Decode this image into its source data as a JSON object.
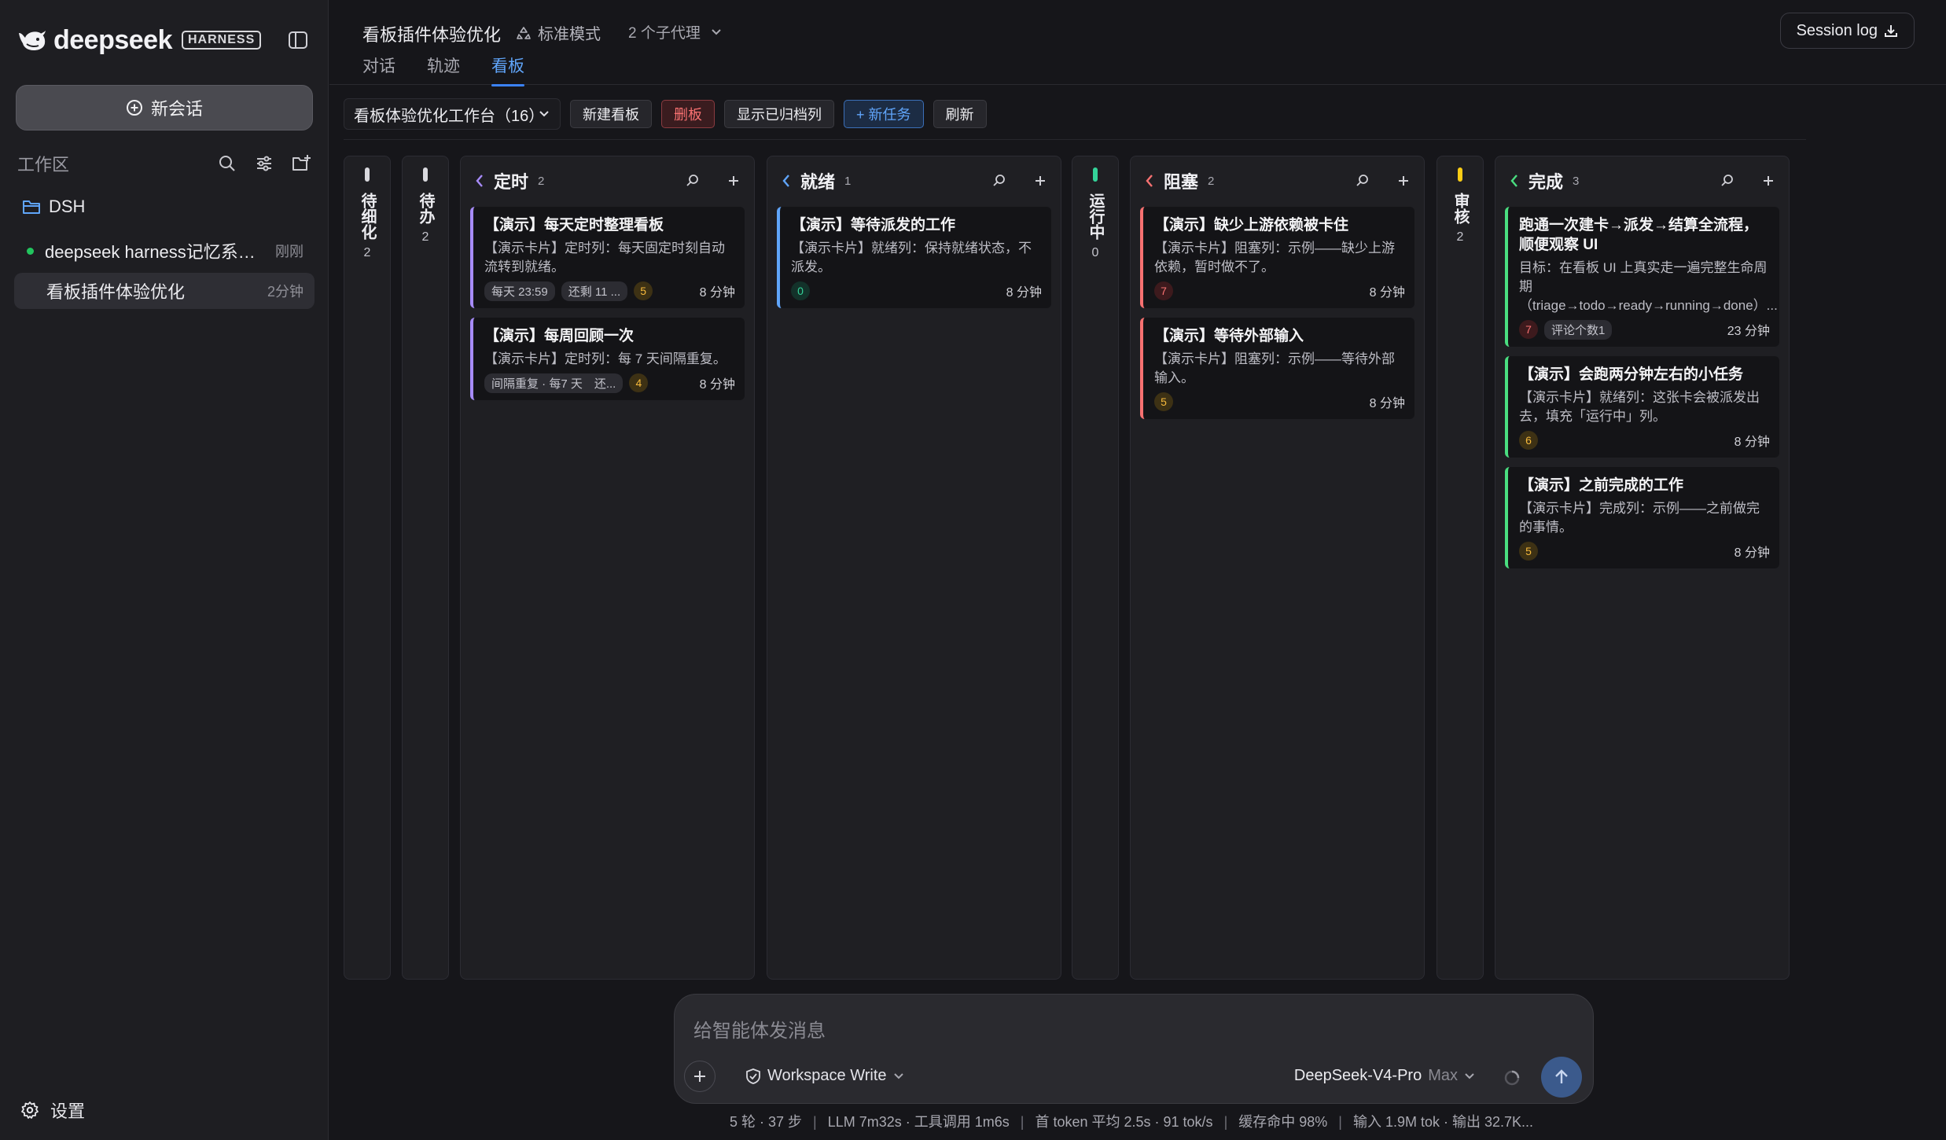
{
  "sidebar": {
    "logo_word": "deepseek",
    "logo_badge": "HARNESS",
    "new_chat_label": "新会话",
    "workspace_title": "工作区",
    "folder_name": "DSH",
    "sessions": [
      {
        "name": "deepseek harness记忆系统工程化落地方案",
        "time": "刚刚",
        "running": true
      },
      {
        "name": "看板插件体验优化",
        "time": "2分钟",
        "active": true
      }
    ],
    "settings_label": "设置"
  },
  "header": {
    "title": "看板插件体验优化",
    "mode": "标准模式",
    "agents": "2 个子代理",
    "tabs": [
      "对话",
      "轨迹",
      "看板"
    ],
    "active_tab": "看板",
    "session_log": "Session log"
  },
  "toolbar": {
    "board_select": "看板体验优化工作台（16）",
    "new_board": "新建看板",
    "delete_board": "删板",
    "show_archived": "显示已归档列",
    "new_task": "+ 新任务",
    "refresh": "刷新"
  },
  "columns": [
    {
      "key": "triage",
      "title": "待细化",
      "count": "2",
      "collapsed": true,
      "color": "#d9d9de"
    },
    {
      "key": "todo",
      "title": "待办",
      "count": "2",
      "collapsed": true,
      "color": "#d9d9de"
    },
    {
      "key": "scheduled",
      "title": "定时",
      "count": "2",
      "collapsed": false,
      "color": "#a78bfa",
      "cards": [
        {
          "title": "【演示】每天定时整理看板",
          "desc": "【演示卡片】定时列：每天固定时刻自动流转到就绪。",
          "tags": [
            "每天 23:59",
            "还剩 11 ..."
          ],
          "prio": "5",
          "prio_color": "y",
          "time": "8 分钟"
        },
        {
          "title": "【演示】每周回顾一次",
          "desc": "【演示卡片】定时列：每 7 天间隔重复。",
          "tags": [
            "间隔重复 · 每7 天　还..."
          ],
          "prio": "4",
          "prio_color": "y",
          "time": "8 分钟"
        }
      ]
    },
    {
      "key": "ready",
      "title": "就绪",
      "count": "1",
      "collapsed": false,
      "color": "#60a5fa",
      "cards": [
        {
          "title": "【演示】等待派发的工作",
          "desc": "【演示卡片】就绪列：保持就绪状态，不派发。",
          "tags": [],
          "prio": "0",
          "prio_color": "g",
          "time": "8 分钟"
        }
      ]
    },
    {
      "key": "running",
      "title": "运行中",
      "count": "0",
      "collapsed": true,
      "color": "#34d399"
    },
    {
      "key": "blocked",
      "title": "阻塞",
      "count": "2",
      "collapsed": false,
      "color": "#f87171",
      "cards": [
        {
          "title": "【演示】缺少上游依赖被卡住",
          "desc": "【演示卡片】阻塞列：示例——缺少上游依赖，暂时做不了。",
          "tags": [],
          "prio": "7",
          "prio_color": "r",
          "time": "8 分钟"
        },
        {
          "title": "【演示】等待外部输入",
          "desc": "【演示卡片】阻塞列：示例——等待外部输入。",
          "tags": [],
          "prio": "5",
          "prio_color": "y",
          "time": "8 分钟"
        }
      ]
    },
    {
      "key": "review",
      "title": "审核",
      "count": "2",
      "collapsed": true,
      "color": "#facc15"
    },
    {
      "key": "done",
      "title": "完成",
      "count": "3",
      "collapsed": false,
      "color": "#4ade80",
      "cards": [
        {
          "title": "跑通一次建卡→派发→结算全流程，顺便观察 UI",
          "desc": "目标：在看板 UI 上真实走一遍完整生命周期（triage→todo→ready→running→done）...",
          "tags": [
            "评论个数1"
          ],
          "prio": "7",
          "prio_color": "r",
          "prio_first": true,
          "time": "23 分钟"
        },
        {
          "title": "【演示】会跑两分钟左右的小任务",
          "desc": "【演示卡片】就绪列：这张卡会被派发出去，填充「运行中」列。",
          "tags": [],
          "prio": "6",
          "prio_color": "y",
          "time": "8 分钟"
        },
        {
          "title": "【演示】之前完成的工作",
          "desc": "【演示卡片】完成列：示例——之前做完的事情。",
          "tags": [],
          "prio": "5",
          "prio_color": "y",
          "time": "8 分钟"
        }
      ]
    }
  ],
  "composer": {
    "placeholder": "给智能体发消息",
    "permission": "Workspace Write",
    "model": "DeepSeek-V4-Pro",
    "level": "Max"
  },
  "status": [
    "5 轮 · 37 步",
    "LLM 7m32s · 工具调用 1m6s",
    "首 token 平均 2.5s · 91 tok/s",
    "缓存命中 98%",
    "输入 1.9M tok · 输出 32.7K..."
  ],
  "colors": {
    "accent": "#3b82f6",
    "sidebar_bg": "#1e1e22",
    "main_bg": "#16161a"
  }
}
